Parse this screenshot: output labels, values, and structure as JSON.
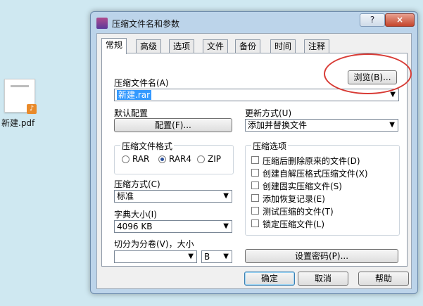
{
  "desktop": {
    "file_label": "新建.pdf"
  },
  "window": {
    "title": "压缩文件名和参数",
    "help": "?",
    "close": "×"
  },
  "tabs": [
    "常规",
    "高级",
    "选项",
    "文件",
    "备份",
    "时间",
    "注释"
  ],
  "archive": {
    "name_label": "压缩文件名(A)",
    "name_value": "新建.rar",
    "browse_label": "浏览(B)..."
  },
  "default_config": {
    "label": "默认配置",
    "button": "配置(F)..."
  },
  "update_mode": {
    "label": "更新方式(U)",
    "value": "添加并替换文件"
  },
  "format_group": {
    "title": "压缩文件格式",
    "options": [
      "RAR",
      "RAR4",
      "ZIP"
    ],
    "selected": "RAR4"
  },
  "compression": {
    "label": "压缩方式(C)",
    "value": "标准"
  },
  "dictionary": {
    "label": "字典大小(I)",
    "value": "4096 KB"
  },
  "split": {
    "label": "切分为分卷(V)，大小",
    "value": "",
    "unit": "B"
  },
  "options_group": {
    "title": "压缩选项",
    "items": [
      "压缩后删除原来的文件(D)",
      "创建自解压格式压缩文件(X)",
      "创建固实压缩文件(S)",
      "添加恢复记录(E)",
      "测试压缩的文件(T)",
      "锁定压缩文件(L)"
    ]
  },
  "password_button": "设置密码(P)...",
  "footer": {
    "ok": "确定",
    "cancel": "取消",
    "help": "帮助"
  },
  "dropdown_arrow": "▼"
}
